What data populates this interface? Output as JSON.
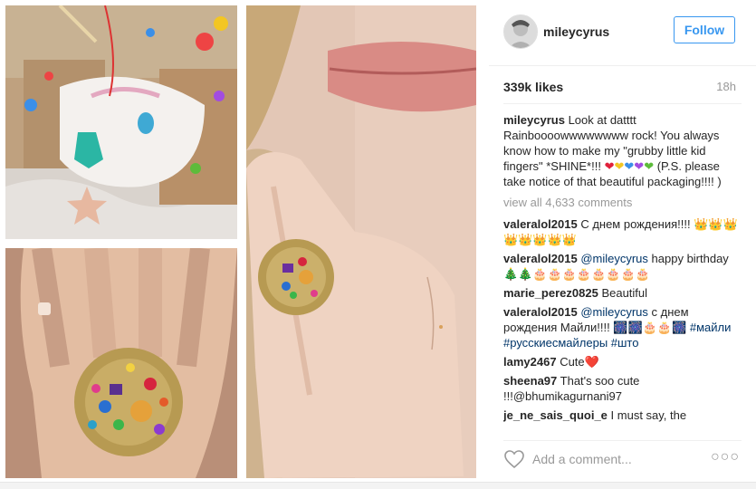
{
  "post": {
    "username": "mileycyrus",
    "follow_label": "Follow",
    "likes": "339k likes",
    "time": "18h",
    "caption_user": "mileycyrus",
    "caption_text": "Look at datttt Rainboooowwwwwwww rock! You always know how to make my \"grubby little kid fingers\" *SHINE*!!!",
    "caption_tail": "(P.S. please take notice of that beautiful packaging!!!! )",
    "view_all": "view all 4,633 comments",
    "add_comment_placeholder": "Add a comment...",
    "more_glyph": "○○○"
  },
  "comments": [
    {
      "user": "valeralol2015",
      "text": "С днем рождения!!!! 👑👑👑👑👑👑👑👑"
    },
    {
      "user": "valeralol2015",
      "mention": "@mileycyrus",
      "text": "happy birthday 🎄🎄🎂🎂🎂🎂🎂🎂🎂🎂"
    },
    {
      "user": "marie_perez0825",
      "text": "Beautiful"
    },
    {
      "user": "valeralol2015",
      "mention": "@mileycyrus",
      "text": "с днем рождения Майли!!!! 🎆🎆🎂🎂🎆",
      "tags": "#майли #русскиесмайлеры #што"
    },
    {
      "user": "lamy2467",
      "text": "Cute❤️"
    },
    {
      "user": "sheena97",
      "text": "That's soo cute !!!@bhumikagurnani97"
    },
    {
      "user": "je_ne_sais_quoi_e",
      "text": "I must say, the"
    }
  ],
  "icons": {
    "heart": "heart-outline-icon",
    "more": "more-options-icon",
    "avatar": "profile-avatar"
  },
  "colors": {
    "accent": "#3897f0",
    "mention": "#003569",
    "muted": "#999999"
  }
}
